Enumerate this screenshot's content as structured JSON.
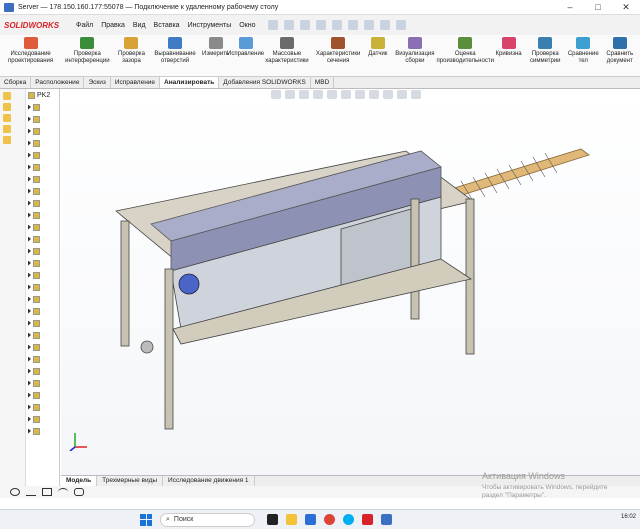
{
  "window": {
    "title": "Server — 178.150.160.177:55078 — Подключение к удаленному рабочему столу"
  },
  "app": {
    "logo": "SOLIDWORKS"
  },
  "menu": [
    "Файл",
    "Правка",
    "Вид",
    "Вставка",
    "Инструменты",
    "Окно"
  ],
  "ribbon": [
    {
      "label": "Исследование проектирования",
      "color": "#e05b3b"
    },
    {
      "label": "Проверка интерференции",
      "color": "#3c8d3a"
    },
    {
      "label": "Проверка зазора",
      "color": "#d9a236"
    },
    {
      "label": "Выравнивание отверстий",
      "color": "#3f7cc3"
    },
    {
      "label": "Измерить",
      "color": "#8a8a8a"
    },
    {
      "label": "Исправление",
      "color": "#5a9ad6"
    },
    {
      "label": "Массовые характеристики",
      "color": "#6b6b6b"
    },
    {
      "label": "Характеристики сечения",
      "color": "#a0522d"
    },
    {
      "label": "Датчик",
      "color": "#c9b037"
    },
    {
      "label": "Визуализация сборки",
      "color": "#8b6fb5"
    },
    {
      "label": "Оценка производительности",
      "color": "#5b8e3a"
    },
    {
      "label": "Кривизна",
      "color": "#d8436b"
    },
    {
      "label": "Проверка симметрии",
      "color": "#3a7fb0"
    },
    {
      "label": "Сравнение тел",
      "color": "#3c9fcf"
    },
    {
      "label": "Сравнить документ",
      "color": "#2f6fab"
    }
  ],
  "tabs": [
    "Сборка",
    "Расположение",
    "Эскиз",
    "Исправление",
    "Анализировать",
    "Добавления SOLIDWORKS",
    "MBD"
  ],
  "active_tab": "Анализировать",
  "tree": {
    "root": "PK2"
  },
  "bottom_tabs": [
    "Модель",
    "Трехмерные виды",
    "Исследование движения 1"
  ],
  "active_bottom_tab": "Модель",
  "watermark": {
    "title": "Активация Windows",
    "line1": "Чтобы активировать Windows, перейдите",
    "line2": "раздел \"Параметры\"."
  },
  "taskbar": {
    "search_placeholder": "Поиск",
    "clock": "16:02"
  }
}
